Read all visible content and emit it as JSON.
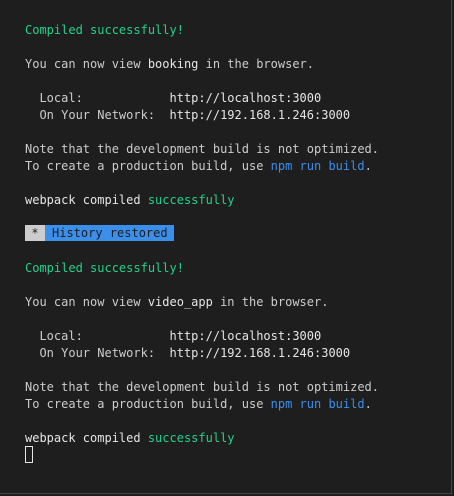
{
  "block1": {
    "compiled": "Compiled successfully!",
    "view_prefix": "You can now view ",
    "app_name": "booking",
    "view_suffix": " in the browser.",
    "local_label": "  Local:            ",
    "local_url": "http://localhost:3000",
    "network_label": "  On Your Network:  ",
    "network_url": "http://192.168.1.246:3000",
    "note": "Note that the development build is not optimized.",
    "prod_prefix": "To create a production build, use ",
    "prod_cmd": "npm run build",
    "prod_suffix": ".",
    "webpack_prefix": "webpack compiled ",
    "webpack_status": "successfully"
  },
  "history": {
    "star": "*",
    "label": "History restored"
  },
  "block2": {
    "compiled": "Compiled successfully!",
    "view_prefix": "You can now view ",
    "app_name": "video_app",
    "view_suffix": " in the browser.",
    "local_label": "  Local:            ",
    "local_url": "http://localhost:3000",
    "network_label": "  On Your Network:  ",
    "network_url": "http://192.168.1.246:3000",
    "note": "Note that the development build is not optimized.",
    "prod_prefix": "To create a production build, use ",
    "prod_cmd": "npm run build",
    "prod_suffix": ".",
    "webpack_prefix": "webpack compiled ",
    "webpack_status": "successfully"
  },
  "colors": {
    "background": "#1e1e1e",
    "text": "#cccccc",
    "success": "#23d18b",
    "command": "#3b8eea",
    "highlight": "#3b8eea"
  }
}
